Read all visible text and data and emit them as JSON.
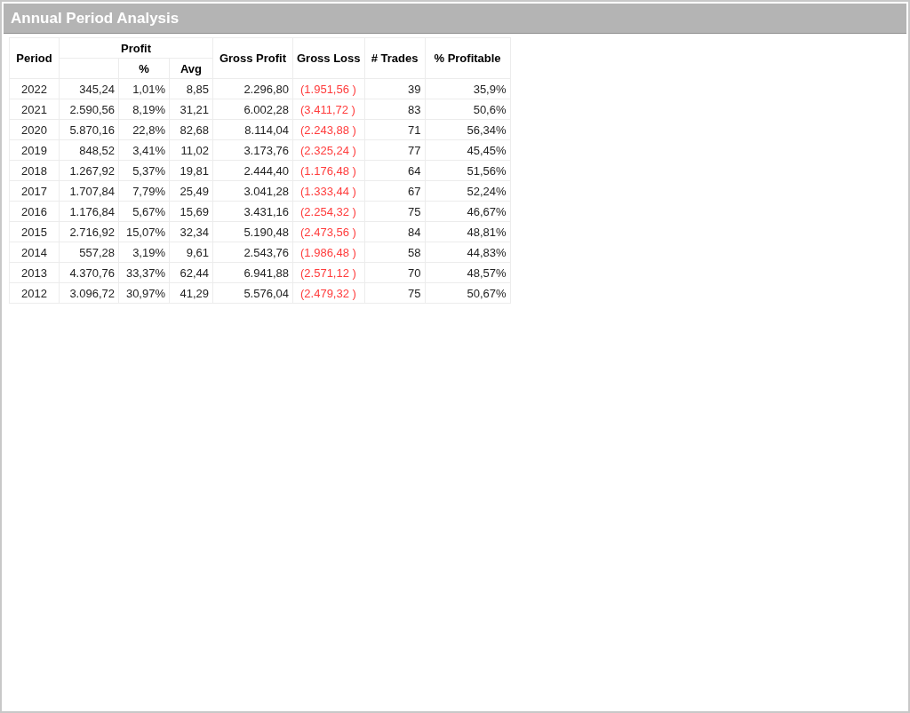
{
  "window": {
    "title": "Annual Period Analysis"
  },
  "table": {
    "columns": [
      {
        "label": "Period",
        "kind": "period"
      },
      {
        "label": "Profit",
        "kind": "group",
        "colspan": 3,
        "sub_columns": [
          {
            "kind": "number"
          },
          {
            "label": "%",
            "kind": "number"
          },
          {
            "label": "Avg",
            "kind": "number"
          }
        ]
      },
      {
        "label": "Gross Profit",
        "kind": "number"
      },
      {
        "label": "Gross Loss",
        "kind": "loss"
      },
      {
        "label": "# Trades",
        "kind": "number"
      },
      {
        "label": "% Profitable",
        "kind": "number"
      }
    ],
    "rows": [
      [
        "2022",
        "345,24",
        "1,01%",
        "8,85",
        "2.296,80",
        "(1.951,56 )",
        "39",
        "35,9%"
      ],
      [
        "2021",
        "2.590,56",
        "8,19%",
        "31,21",
        "6.002,28",
        "(3.411,72 )",
        "83",
        "50,6%"
      ],
      [
        "2020",
        "5.870,16",
        "22,8%",
        "82,68",
        "8.114,04",
        "(2.243,88 )",
        "71",
        "56,34%"
      ],
      [
        "2019",
        "848,52",
        "3,41%",
        "11,02",
        "3.173,76",
        "(2.325,24 )",
        "77",
        "45,45%"
      ],
      [
        "2018",
        "1.267,92",
        "5,37%",
        "19,81",
        "2.444,40",
        "(1.176,48 )",
        "64",
        "51,56%"
      ],
      [
        "2017",
        "1.707,84",
        "7,79%",
        "25,49",
        "3.041,28",
        "(1.333,44 )",
        "67",
        "52,24%"
      ],
      [
        "2016",
        "1.176,84",
        "5,67%",
        "15,69",
        "3.431,16",
        "(2.254,32 )",
        "75",
        "46,67%"
      ],
      [
        "2015",
        "2.716,92",
        "15,07%",
        "32,34",
        "5.190,48",
        "(2.473,56 )",
        "84",
        "48,81%"
      ],
      [
        "2014",
        "557,28",
        "3,19%",
        "9,61",
        "2.543,76",
        "(1.986,48 )",
        "58",
        "44,83%"
      ],
      [
        "2013",
        "4.370,76",
        "33,37%",
        "62,44",
        "6.941,88",
        "(2.571,12 )",
        "70",
        "48,57%"
      ],
      [
        "2012",
        "3.096,72",
        "30,97%",
        "41,29",
        "5.576,04",
        "(2.479,32 )",
        "75",
        "50,67%"
      ]
    ]
  }
}
